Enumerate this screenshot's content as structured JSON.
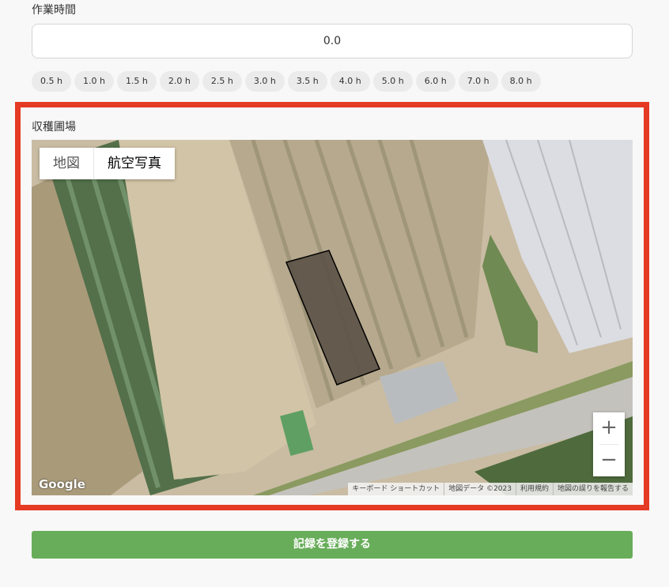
{
  "work_time": {
    "label": "作業時間",
    "value": "0.0",
    "presets": [
      "0.5 h",
      "1.0 h",
      "1.5 h",
      "2.0 h",
      "2.5 h",
      "3.0 h",
      "3.5 h",
      "4.0 h",
      "5.0 h",
      "6.0 h",
      "7.0 h",
      "8.0 h"
    ]
  },
  "harvest_field": {
    "label": "収穫圃場",
    "map": {
      "type_buttons": {
        "map": "地図",
        "satellite": "航空写真"
      },
      "active_type": "satellite",
      "zoom_in": "+",
      "zoom_out": "−",
      "logo": "Google",
      "attribution": [
        "キーボード ショートカット",
        "地図データ ©2023",
        "利用規約",
        "地図の誤りを報告する"
      ]
    }
  },
  "submit": {
    "label": "記録を登録する"
  },
  "colors": {
    "highlight_border": "#e53a23",
    "submit_bg": "#68ad5a"
  }
}
